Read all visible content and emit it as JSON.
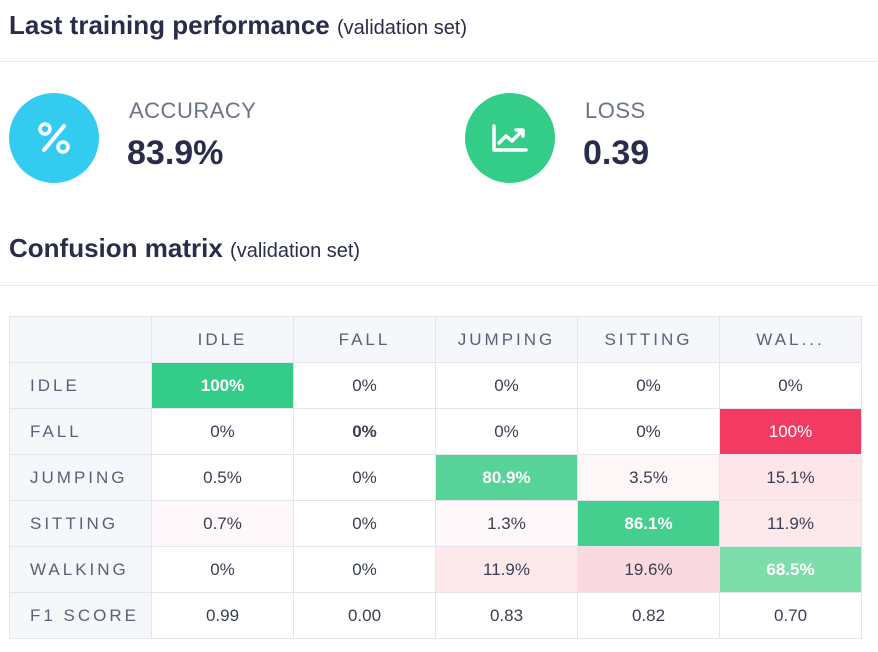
{
  "performance": {
    "title": "Last training performance",
    "subtitle": "(validation set)",
    "accuracy": {
      "label": "ACCURACY",
      "value": "83.9%",
      "icon": "percent-icon",
      "color": "#33ccf0"
    },
    "loss": {
      "label": "LOSS",
      "value": "0.39",
      "icon": "chart-trend-icon",
      "color": "#33cc88"
    }
  },
  "confusion": {
    "title": "Confusion matrix",
    "subtitle": "(validation set)",
    "columns": [
      "IDLE",
      "FALL",
      "JUMPING",
      "SITTING",
      "WAL..."
    ],
    "rows": [
      {
        "label": "IDLE",
        "cells": [
          "100%",
          "0%",
          "0%",
          "0%",
          "0%"
        ]
      },
      {
        "label": "FALL",
        "cells": [
          "0%",
          "0%",
          "0%",
          "0%",
          "100%"
        ]
      },
      {
        "label": "JUMPING",
        "cells": [
          "0.5%",
          "0%",
          "80.9%",
          "3.5%",
          "15.1%"
        ]
      },
      {
        "label": "SITTING",
        "cells": [
          "0.7%",
          "0%",
          "1.3%",
          "86.1%",
          "11.9%"
        ]
      },
      {
        "label": "WALKING",
        "cells": [
          "0%",
          "0%",
          "11.9%",
          "19.6%",
          "68.5%"
        ]
      }
    ],
    "f1": {
      "label": "F1 SCORE",
      "cells": [
        "0.99",
        "0.00",
        "0.83",
        "0.82",
        "0.70"
      ]
    },
    "colors": {
      "correct": "#33cc88",
      "wrong": "#f23a62",
      "light_green": "#7dddab",
      "light_pink": "#fde5ea",
      "pale_pink": "#fff6f8"
    }
  }
}
